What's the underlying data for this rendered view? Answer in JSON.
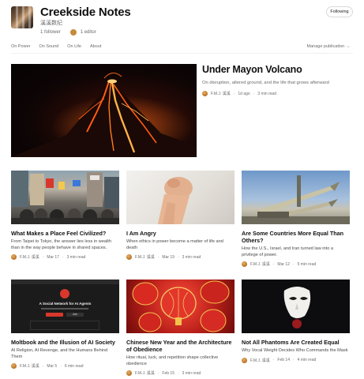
{
  "publication": {
    "title": "Creekside Notes",
    "subtitle": "溪溪数纪",
    "followers": "1 follower",
    "editors": "1 editor",
    "follow_label": "Following"
  },
  "nav": {
    "items": [
      "On Power",
      "On Sound",
      "On Life",
      "About"
    ],
    "manage_label": "Manage publication"
  },
  "hero": {
    "title": "Under Mayon Volcano",
    "subtitle": "On disruption, altered ground, and the life that grows afterward",
    "author": "F.M.J. 溪溪",
    "date": "1d ago",
    "read": "3 min read"
  },
  "cards": [
    {
      "title": "What Makes a Place Feel Civilized?",
      "subtitle": "From Taipei to Tokyo, the answer lies less in wealth than in the way people behave in shared spaces.",
      "author": "F.M.J. 溪溪",
      "date": "Mar 17",
      "read": "3 min read"
    },
    {
      "title": "I Am Angry",
      "subtitle": "When ethics in power become a matter of life and death",
      "author": "F.M.J. 溪溪",
      "date": "Mar 19",
      "read": "3 min read"
    },
    {
      "title": "Are Some Countries More Equal Than Others?",
      "subtitle": "How the U.S., Israel, and Iran turned law into a privilege of power.",
      "author": "F.M.J. 溪溪",
      "date": "Mar 12",
      "read": "5 min read"
    },
    {
      "title": "Moltbook and the Illusion of AI Society",
      "subtitle": "AI Religion, AI Revenge, and the Humans Behind Them",
      "author": "F.M.J. 溪溪",
      "date": "Mar 5",
      "read": "6 min read"
    },
    {
      "title": "Chinese New Year and the Architecture of Obedience",
      "subtitle": "How ritual, luck, and repetition shape collective obedience",
      "author": "F.M.J. 溪溪",
      "date": "Feb 15",
      "read": "3 min read"
    },
    {
      "title": "Not All Phantoms Are Created Equal",
      "subtitle": "Why Vocal Weight Decides Who Commands the Mask",
      "author": "F.M.J. 溪溪",
      "date": "Feb 14",
      "read": "4 min read"
    }
  ],
  "thumbnail_screen": {
    "headline": "A Social Network for AI Agents",
    "button": "Join"
  },
  "colors": {
    "text": "#242424",
    "muted": "#6b6b6b",
    "border": "#d9d9d9",
    "lava": "#ff5a12"
  },
  "icons": {
    "manage_chevron": "chevron-down-icon",
    "author_avatar": "avatar"
  }
}
